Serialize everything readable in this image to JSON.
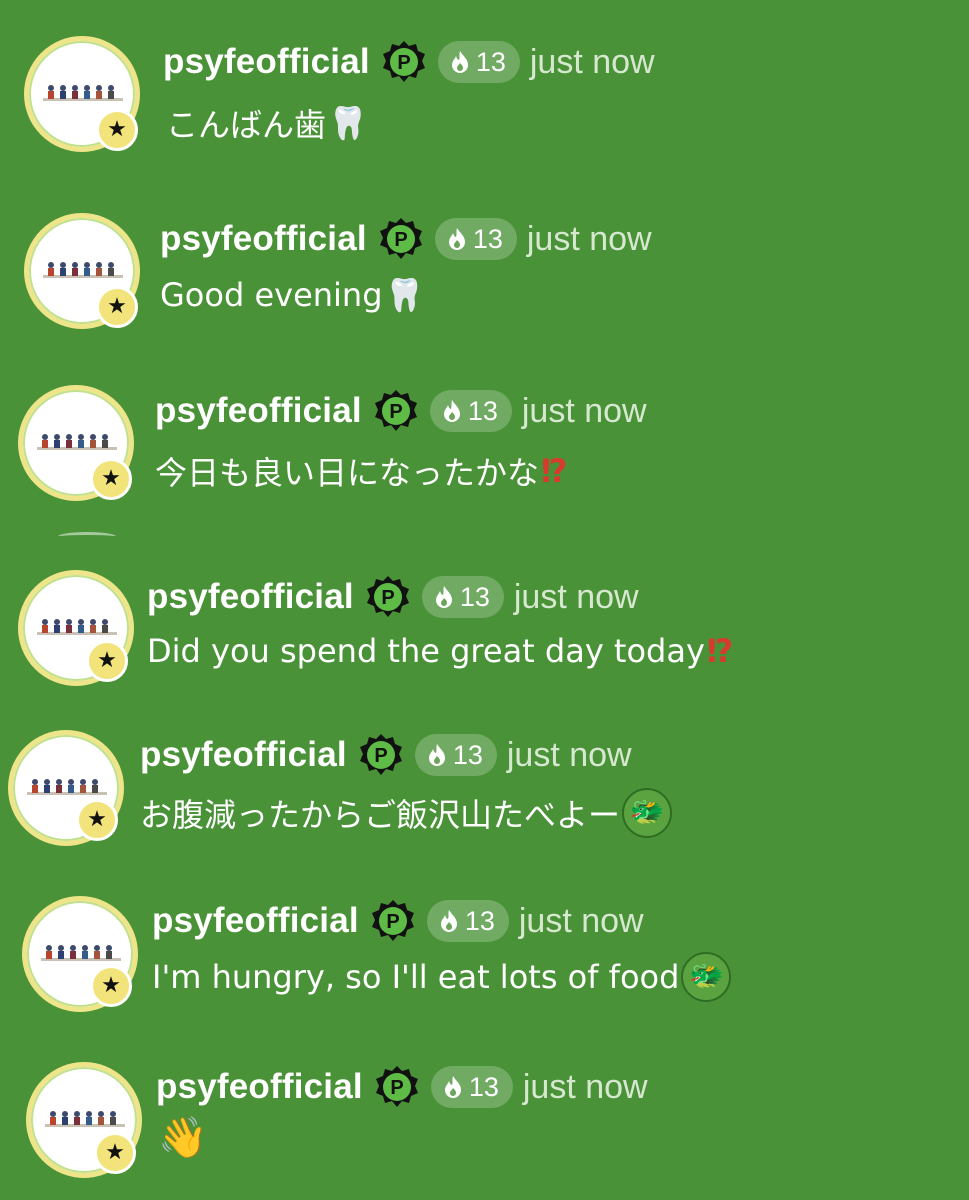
{
  "messages": [
    {
      "username": "psyfeofficial",
      "premium_badge": "P",
      "level": "13",
      "time": "just now",
      "text": "こんばん歯",
      "emoji_icon": "tooth-icon",
      "emoji_glyph": "🦷"
    },
    {
      "username": "psyfeofficial",
      "premium_badge": "P",
      "level": "13",
      "time": "just now",
      "text": "Good evening",
      "emoji_icon": "tooth-icon",
      "emoji_glyph": "🦷"
    },
    {
      "username": "psyfeofficial",
      "premium_badge": "P",
      "level": "13",
      "time": "just now",
      "text": "今日も良い日になったかな",
      "emoji_icon": "exclamation-question-icon",
      "emoji_glyph": "⁉"
    },
    {
      "username": "psyfeofficial",
      "premium_badge": "P",
      "level": "13",
      "time": "just now",
      "text": "Did you spend the great day today",
      "emoji_icon": "exclamation-question-icon",
      "emoji_glyph": "⁉"
    },
    {
      "username": "psyfeofficial",
      "premium_badge": "P",
      "level": "13",
      "time": "just now",
      "text": "お腹減ったからご飯沢山たべよー",
      "emoji_icon": "dragon-face-icon",
      "emoji_glyph": "🐲"
    },
    {
      "username": "psyfeofficial",
      "premium_badge": "P",
      "level": "13",
      "time": "just now",
      "text": "I'm hungry, so I'll eat lots of food",
      "emoji_icon": "dragon-face-icon",
      "emoji_glyph": "🐲"
    },
    {
      "username": "psyfeofficial",
      "premium_badge": "P",
      "level": "13",
      "time": "just now",
      "text": "",
      "emoji_icon": "waving-hand-icon",
      "emoji_glyph": "👋"
    }
  ],
  "colors": {
    "background": "#4a9238",
    "avatar_ring": "#eee58a",
    "star_badge": "#f3e37b",
    "premium_badge_fill": "#5dbb46",
    "premium_badge_outline": "#111111",
    "level_pill": "rgba(255,255,255,0.22)",
    "timestamp": "#d6e8cf"
  },
  "icons": {
    "avatar_badge": "star-icon",
    "level_pill": "flame-icon",
    "premium": "premium-p-badge-icon"
  }
}
